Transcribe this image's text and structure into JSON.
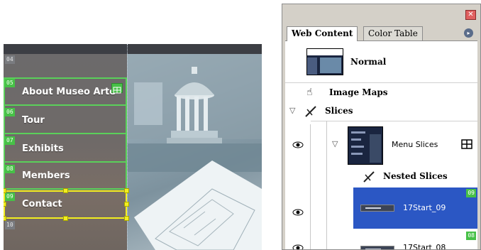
{
  "canvas": {
    "slices": [
      {
        "tag": "04",
        "label": ""
      },
      {
        "tag": "05",
        "label": "About Museo Arte"
      },
      {
        "tag": "06",
        "label": "Tour"
      },
      {
        "tag": "07",
        "label": "Exhibits"
      },
      {
        "tag": "08",
        "label": "Members"
      },
      {
        "tag": "09",
        "label": "Contact"
      },
      {
        "tag": "10",
        "label": ""
      }
    ],
    "highlight_color": "#5ad05a",
    "selection_color": "#f2ee20"
  },
  "panel": {
    "close_label": "✕",
    "tabs": [
      {
        "label": "Web Content",
        "active": true
      },
      {
        "label": "Color Table",
        "active": false
      }
    ],
    "menu_label": "▸",
    "items": {
      "normal": "Normal",
      "image_maps": "Image Maps",
      "slices": "Slices",
      "menu_slices": "Menu Slices",
      "nested_slices": "Nested Slices",
      "start_09": "17Start_09",
      "start_08": "17Start_08",
      "tag_09": "09",
      "tag_08": "08"
    },
    "selected_color": "#2b57c4",
    "tag_color": "#47c047"
  }
}
